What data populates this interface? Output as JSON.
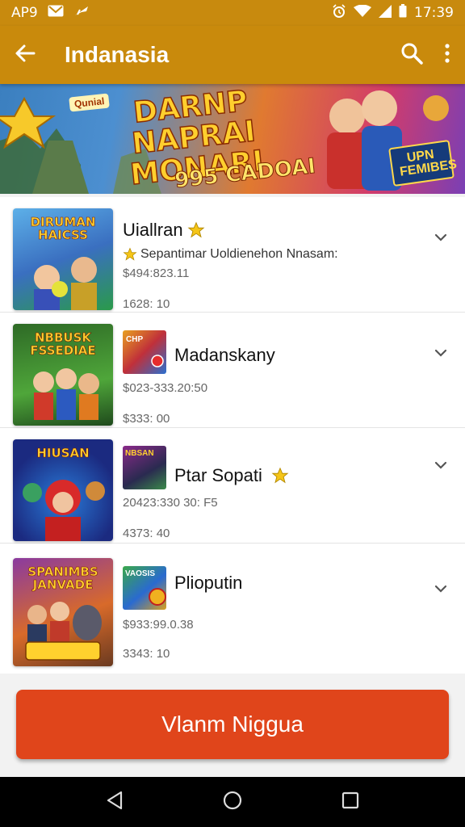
{
  "status_bar": {
    "carrier": "AP9",
    "time": "17:39",
    "icons": [
      "mail-icon",
      "signal-mute-icon",
      "alarm-icon",
      "wifi-icon",
      "cell-signal-icon",
      "battery-icon"
    ]
  },
  "app_bar": {
    "title": "Indanasia",
    "back_icon": "arrow-left-icon",
    "search_icon": "search-icon",
    "menu_icon": "more-vert-icon"
  },
  "banner": {
    "tag": "Qunial",
    "headline": "DARNP NAPRAI MONARI",
    "promo": "995 CADOAI",
    "corner": "UPN FEMIBES"
  },
  "items": [
    {
      "thumb_text": "DIRUMAN HAICSS",
      "title": "Uiallran",
      "starred": true,
      "line1": "Sepantimar Uoldienehon Nnasam:",
      "line1_star": true,
      "line2": "$494:823.11",
      "line3": "1628: 10"
    },
    {
      "thumb_text": "NBBUSK FSSEDIAE",
      "mini_text": "CHP",
      "title": "Madanskany",
      "starred": false,
      "line2": "$023-333.20:50",
      "line3": "$333: 00"
    },
    {
      "thumb_text": "HIUSAN",
      "mini_text": "NBSAN",
      "title": "Ptar Sopati",
      "starred": true,
      "line2": "20423:330 30: F5",
      "line3": "4373: 40"
    },
    {
      "thumb_text": "SPANIMBS JANVADE",
      "mini_text": "VAOSIS",
      "title": "Plioputin",
      "starred": false,
      "line2": "$933:99.0.38",
      "line3": "3343: 10"
    }
  ],
  "cta": {
    "label": "Vlanm Niggua"
  },
  "nav": {
    "back": "nav-back-icon",
    "home": "nav-home-icon",
    "recents": "nav-recents-icon"
  },
  "colors": {
    "primary": "#c98a0c",
    "cta": "#e0451b",
    "star": "#f5c518"
  }
}
